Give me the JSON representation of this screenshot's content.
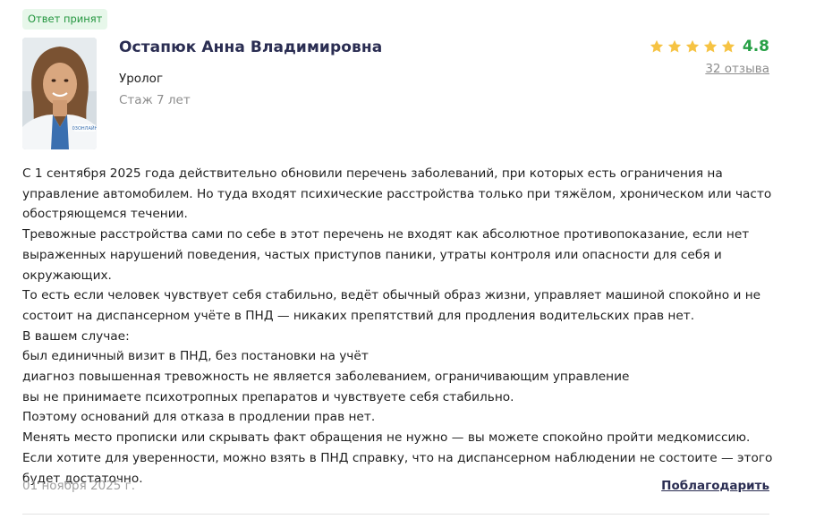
{
  "status_badge": "Ответ принят",
  "doctor": {
    "name": "Остапюк Анна Владимировна",
    "specialty": "Уролог",
    "experience": "Стаж 7 лет",
    "photo_watermark": "03ОНЛАЙН"
  },
  "rating": {
    "value": "4.8",
    "stars": 5,
    "reviews_link": "32 отзыва",
    "star_color": "#f6c343",
    "value_color": "#27a046"
  },
  "answer_lines": [
    "С 1 сентября 2025 года действительно обновили перечень заболеваний, при которых есть ограничения на управление автомобилем. Но туда входят психические расстройства только при тяжёлом, хроническом или часто обостряющемся течении.",
    "Тревожные расстройства сами по себе в этот перечень не входят как абсолютное противопоказание, если нет выраженных нарушений поведения, частых приступов паники, утраты контроля или опасности для себя и окружающих.",
    "То есть если человек чувствует себя стабильно, ведёт обычный образ жизни, управляет машиной спокойно и не состоит на диспансерном учёте в ПНД — никаких препятствий для продления водительских прав нет.",
    "В вашем случае:",
    "был единичный визит в ПНД, без постановки на учёт",
    "диагноз повышенная тревожность не является заболеванием, ограничивающим управление",
    "вы не принимаете психотропных препаратов и чувствуете себя стабильно.",
    "Поэтому оснований для отказа в продлении прав нет.",
    "Менять место прописки или скрывать факт обращения не нужно — вы можете спокойно пройти медкомиссию.",
    "Если хотите для уверенности, можно взять в ПНД справку, что на диспансерном наблюдении не состоите — этого будет достаточно."
  ],
  "footer": {
    "date": "01 ноября 2025 г.",
    "thank_button": "Поблагодарить"
  },
  "colors": {
    "name": "#2a2d52",
    "badge_bg": "#e7f7ea",
    "badge_text": "#23963f",
    "muted": "#8d8d8d"
  }
}
